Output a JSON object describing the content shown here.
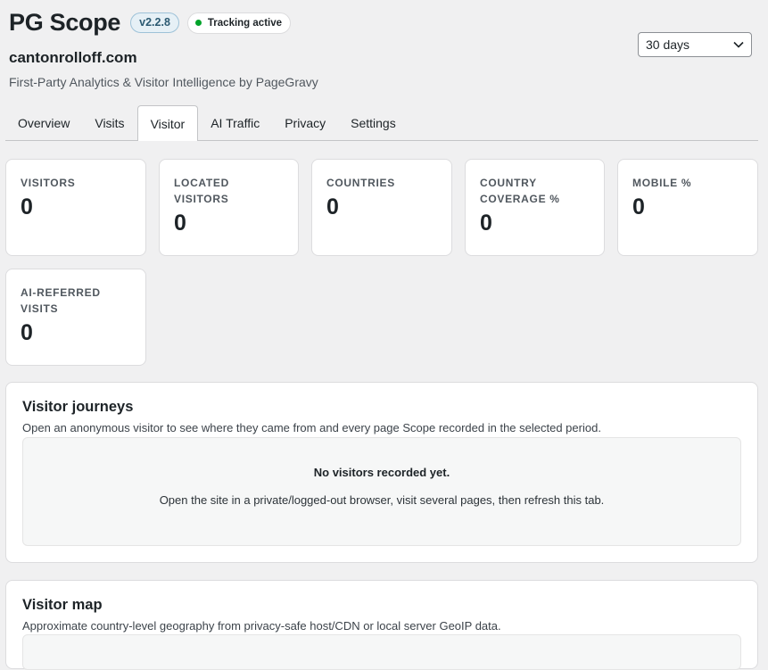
{
  "header": {
    "title": "PG Scope",
    "version": "v2.2.8",
    "status": "Tracking active",
    "site": "cantonrolloff.com",
    "tagline": "First-Party Analytics & Visitor Intelligence by PageGravy"
  },
  "range_select": {
    "value": "30 days",
    "icon": "chevron-down-icon"
  },
  "tabs": [
    {
      "label": "Overview"
    },
    {
      "label": "Visits"
    },
    {
      "label": "Visitor",
      "active": true
    },
    {
      "label": "AI Traffic"
    },
    {
      "label": "Privacy"
    },
    {
      "label": "Settings"
    }
  ],
  "stats": [
    {
      "label": "VISITORS",
      "value": "0"
    },
    {
      "label": "LOCATED VISITORS",
      "value": "0"
    },
    {
      "label": "COUNTRIES",
      "value": "0"
    },
    {
      "label": "COUNTRY COVERAGE %",
      "value": "0"
    },
    {
      "label": "MOBILE %",
      "value": "0"
    },
    {
      "label": "AI-REFERRED VISITS",
      "value": "0"
    }
  ],
  "journeys": {
    "title": "Visitor journeys",
    "description": "Open an anonymous visitor to see where they came from and every page Scope recorded in the selected period.",
    "empty_title": "No visitors recorded yet.",
    "empty_hint": "Open the site in a private/logged-out browser, visit several pages, then refresh this tab."
  },
  "map": {
    "title": "Visitor map",
    "description": "Approximate country-level geography from privacy-safe host/CDN or local server GeoIP data."
  },
  "colors": {
    "background": "#f0f0f1",
    "status_dot": "#00a32a",
    "version_badge_bg": "#e6f0f6",
    "version_badge_text": "#2c5a72"
  }
}
